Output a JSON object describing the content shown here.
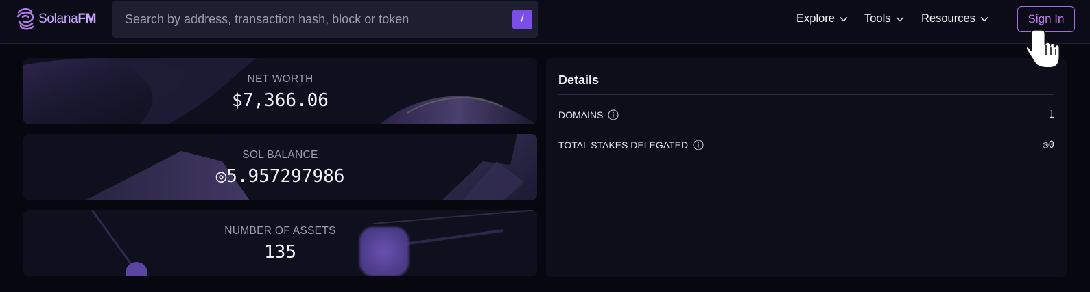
{
  "brand": {
    "name_light": "Solana",
    "name_bold": "FM",
    "logo_icon": "solanafm-swirl-icon",
    "accent": "#7c4ee8"
  },
  "search": {
    "placeholder": "Search by address, transaction hash, block or token",
    "value": "",
    "shortcut_key": "/"
  },
  "nav": {
    "items": [
      {
        "label": "Explore"
      },
      {
        "label": "Tools"
      },
      {
        "label": "Resources"
      }
    ],
    "signin_label": "Sign In"
  },
  "stats": [
    {
      "label": "NET WORTH",
      "value": "$7,366.06"
    },
    {
      "label": "SOL BALANCE",
      "value": "◎5.957297986"
    },
    {
      "label": "NUMBER OF ASSETS",
      "value": "135"
    }
  ],
  "details": {
    "title": "Details",
    "rows": [
      {
        "label": "DOMAINS",
        "value": "1"
      },
      {
        "label": "TOTAL STAKES DELEGATED",
        "value": "◎0"
      }
    ]
  }
}
